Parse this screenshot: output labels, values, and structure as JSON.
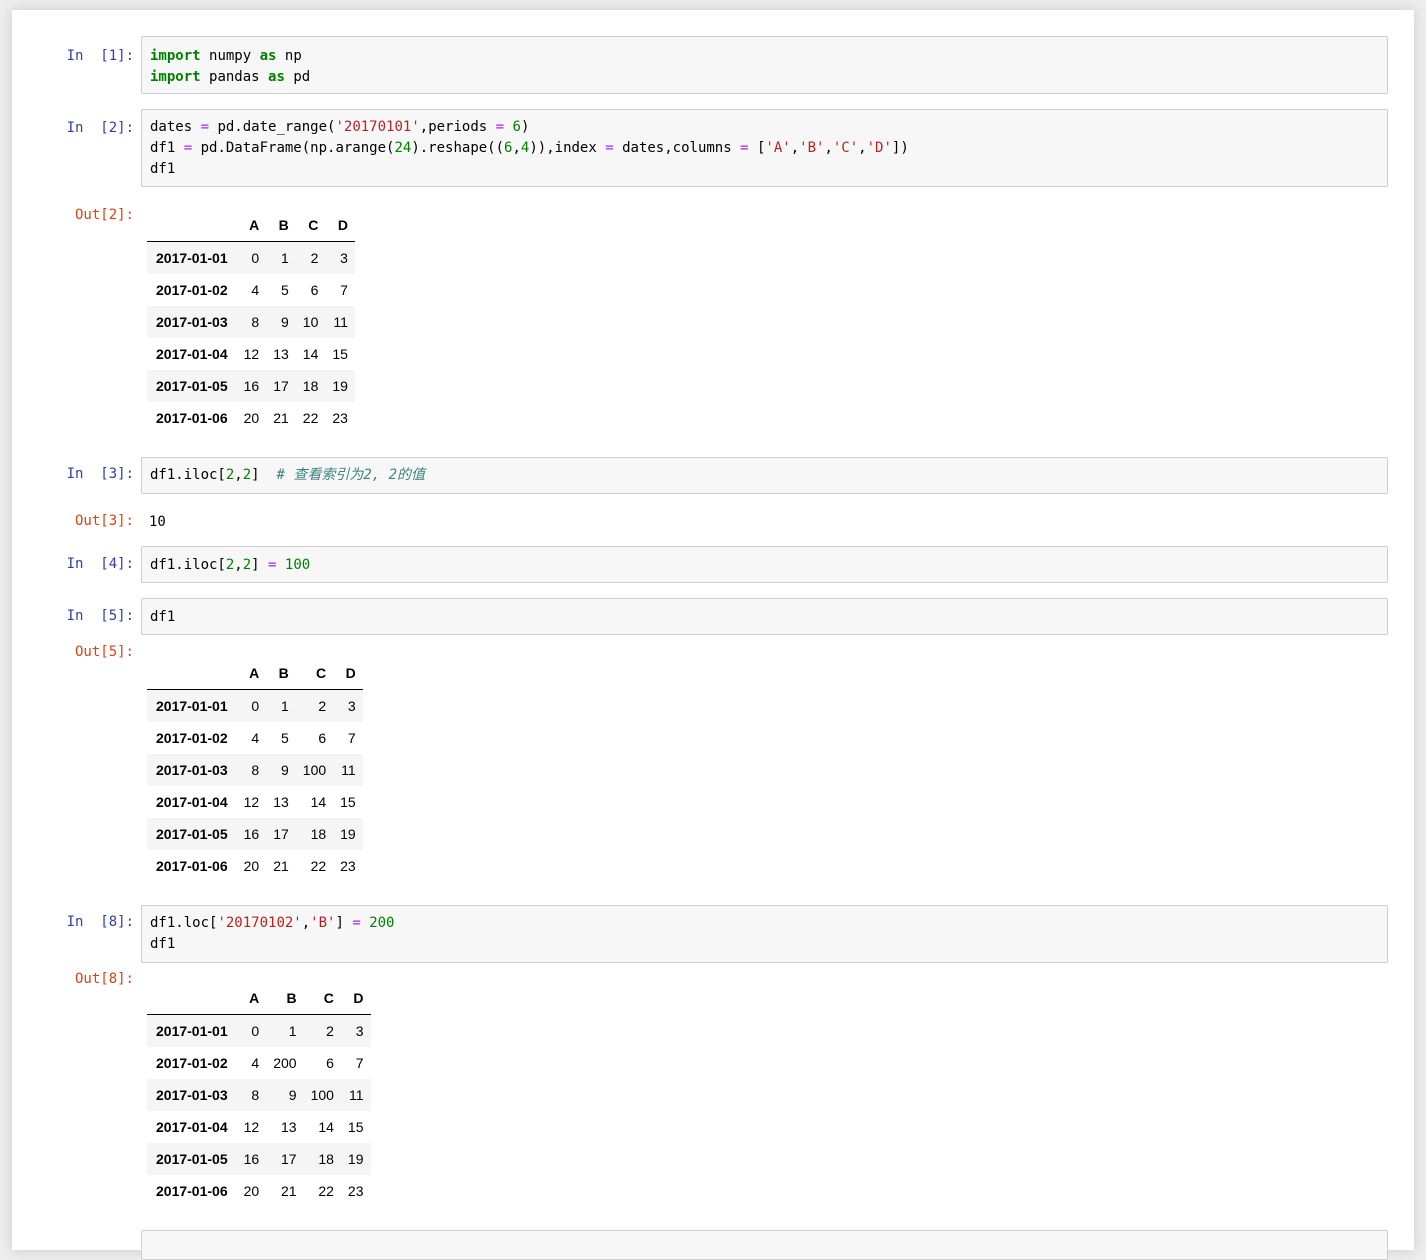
{
  "cells": {
    "c1": {
      "in_prompt": "In  [1]:"
    },
    "c2": {
      "in_prompt": "In  [2]:",
      "out_prompt": "Out[2]:",
      "table": {
        "columns": [
          "A",
          "B",
          "C",
          "D"
        ],
        "rows": [
          {
            "index": "2017-01-01",
            "values": [
              "0",
              "1",
              "2",
              "3"
            ]
          },
          {
            "index": "2017-01-02",
            "values": [
              "4",
              "5",
              "6",
              "7"
            ]
          },
          {
            "index": "2017-01-03",
            "values": [
              "8",
              "9",
              "10",
              "11"
            ]
          },
          {
            "index": "2017-01-04",
            "values": [
              "12",
              "13",
              "14",
              "15"
            ]
          },
          {
            "index": "2017-01-05",
            "values": [
              "16",
              "17",
              "18",
              "19"
            ]
          },
          {
            "index": "2017-01-06",
            "values": [
              "20",
              "21",
              "22",
              "23"
            ]
          }
        ]
      }
    },
    "c3": {
      "in_prompt": "In  [3]:",
      "out_prompt": "Out[3]:",
      "output": "10"
    },
    "c4": {
      "in_prompt": "In  [4]:"
    },
    "c5": {
      "in_prompt": "In  [5]:",
      "out_prompt": "Out[5]:",
      "table": {
        "columns": [
          "A",
          "B",
          "C",
          "D"
        ],
        "rows": [
          {
            "index": "2017-01-01",
            "values": [
              "0",
              "1",
              "2",
              "3"
            ]
          },
          {
            "index": "2017-01-02",
            "values": [
              "4",
              "5",
              "6",
              "7"
            ]
          },
          {
            "index": "2017-01-03",
            "values": [
              "8",
              "9",
              "100",
              "11"
            ]
          },
          {
            "index": "2017-01-04",
            "values": [
              "12",
              "13",
              "14",
              "15"
            ]
          },
          {
            "index": "2017-01-05",
            "values": [
              "16",
              "17",
              "18",
              "19"
            ]
          },
          {
            "index": "2017-01-06",
            "values": [
              "20",
              "21",
              "22",
              "23"
            ]
          }
        ]
      }
    },
    "c8": {
      "in_prompt": "In  [8]:",
      "out_prompt": "Out[8]:",
      "table": {
        "columns": [
          "A",
          "B",
          "C",
          "D"
        ],
        "rows": [
          {
            "index": "2017-01-01",
            "values": [
              "0",
              "1",
              "2",
              "3"
            ]
          },
          {
            "index": "2017-01-02",
            "values": [
              "4",
              "200",
              "6",
              "7"
            ]
          },
          {
            "index": "2017-01-03",
            "values": [
              "8",
              "9",
              "100",
              "11"
            ]
          },
          {
            "index": "2017-01-04",
            "values": [
              "12",
              "13",
              "14",
              "15"
            ]
          },
          {
            "index": "2017-01-05",
            "values": [
              "16",
              "17",
              "18",
              "19"
            ]
          },
          {
            "index": "2017-01-06",
            "values": [
              "20",
              "21",
              "22",
              "23"
            ]
          }
        ]
      }
    }
  },
  "code": {
    "c1": [
      [
        [
          "kw",
          "import"
        ],
        [
          "",
          "numpy"
        ],
        [
          "kw",
          "as"
        ],
        [
          "",
          "np"
        ]
      ],
      [
        [
          "kw",
          "import"
        ],
        [
          "",
          "pandas"
        ],
        [
          "kw",
          "as"
        ],
        [
          "",
          "pd"
        ]
      ]
    ],
    "c2": [
      [
        [
          "",
          "dates"
        ],
        [
          "op",
          "="
        ],
        [
          "",
          "pd.date_range("
        ],
        [
          "str",
          "'20170101'"
        ],
        [
          "",
          ",periods"
        ],
        [
          "op",
          "="
        ],
        [
          "num",
          "6"
        ],
        [
          "",
          ")"
        ]
      ],
      [
        [
          "",
          "df1"
        ],
        [
          "op",
          "="
        ],
        [
          "",
          "pd.DataFrame(np.arange("
        ],
        [
          "num",
          "24"
        ],
        [
          "",
          ").reshape(("
        ],
        [
          "num",
          "6"
        ],
        [
          "",
          ","
        ],
        [
          "num",
          "4"
        ],
        [
          "",
          ")),index"
        ],
        [
          "op",
          "="
        ],
        [
          "",
          "dates,columns"
        ],
        [
          "op",
          "="
        ],
        [
          "",
          "["
        ],
        [
          "str",
          "'A'"
        ],
        [
          "",
          ","
        ],
        [
          "str",
          "'B'"
        ],
        [
          "",
          ","
        ],
        [
          "str",
          "'C'"
        ],
        [
          "",
          ","
        ],
        [
          "str",
          "'D'"
        ],
        [
          "",
          "])"
        ]
      ],
      [
        [
          "",
          "df1"
        ]
      ]
    ],
    "c3": [
      [
        [
          "",
          "df1.iloc["
        ],
        [
          "num",
          "2"
        ],
        [
          "",
          ","
        ],
        [
          "num",
          "2"
        ],
        [
          "",
          "]"
        ],
        [
          "cm",
          "# 查看索引为2, 2的值"
        ]
      ]
    ],
    "c4": [
      [
        [
          "",
          "df1.iloc["
        ],
        [
          "num",
          "2"
        ],
        [
          "",
          ","
        ],
        [
          "num",
          "2"
        ],
        [
          "",
          "]"
        ],
        [
          "op",
          "="
        ],
        [
          "num",
          "100"
        ]
      ]
    ],
    "c5": [
      [
        [
          "",
          "df1"
        ]
      ]
    ],
    "c8": [
      [
        [
          "",
          "df1.loc["
        ],
        [
          "str",
          "'20170102'"
        ],
        [
          "",
          ","
        ],
        [
          "str",
          "'B'"
        ],
        [
          "",
          "]"
        ],
        [
          "op",
          "="
        ],
        [
          "num",
          "200"
        ]
      ],
      [
        [
          "",
          "df1"
        ]
      ]
    ]
  }
}
